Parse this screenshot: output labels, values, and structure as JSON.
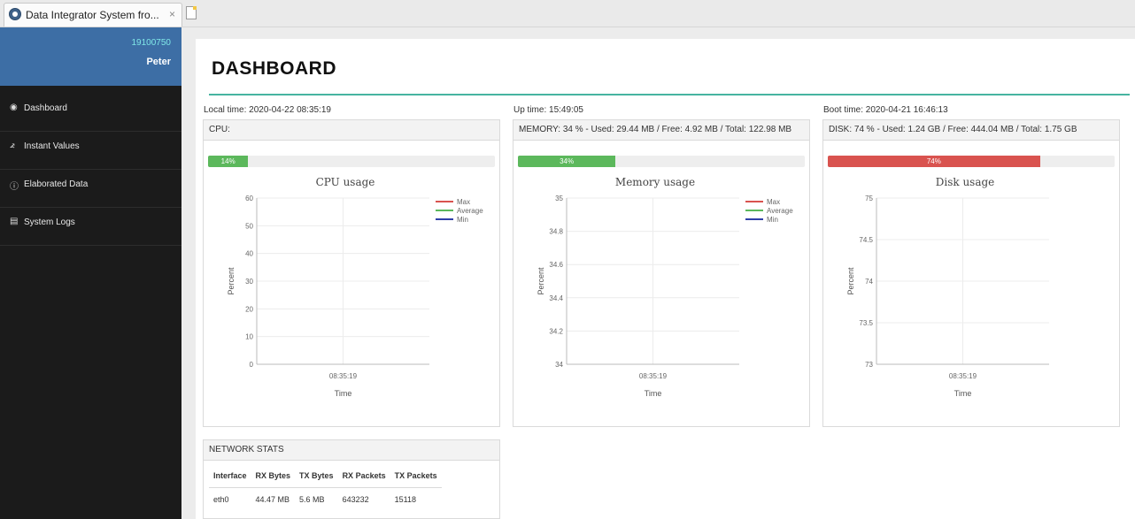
{
  "browser": {
    "tab_title": "Data Integrator System fro...",
    "tab_close": "×"
  },
  "sidebar": {
    "user_id": "19100750",
    "user_name": "Peter",
    "items": [
      {
        "label": "Dashboard",
        "icon": "dashboard-icon",
        "glyph": "◉"
      },
      {
        "label": "Instant Values",
        "icon": "line-chart-icon",
        "glyph": "⦨"
      },
      {
        "label": "Elaborated Data",
        "icon": "info-icon",
        "glyph": "ⓘ"
      },
      {
        "label": "System Logs",
        "icon": "list-icon",
        "glyph": "▤"
      }
    ]
  },
  "header": {
    "title": "DASHBOARD",
    "accent_color": "#46b4a0"
  },
  "info": {
    "local_time": "Local time: 2020-04-22 08:35:19",
    "up_time": "Up time: 15:49:05",
    "boot_time": "Boot time: 2020-04-21 16:46:13"
  },
  "cards": {
    "cpu": {
      "header": "CPU:",
      "percent": 14,
      "percent_label": "14%",
      "bar_color": "#5cb85c"
    },
    "memory": {
      "header": "MEMORY: 34 % - Used: 29.44 MB / Free: 4.92 MB / Total: 122.98 MB",
      "percent": 34,
      "percent_label": "34%",
      "bar_color": "#5cb85c"
    },
    "disk": {
      "header": "DISK: 74 % - Used: 1.24 GB / Free: 444.04 MB / Total: 1.75 GB",
      "percent": 74,
      "percent_label": "74%",
      "bar_color": "#d9534f"
    }
  },
  "chart_data": [
    {
      "type": "line",
      "title": "CPU usage",
      "xlabel": "Time",
      "ylabel": "Percent",
      "x": [
        "08:35:19"
      ],
      "yticks": [
        0,
        10,
        20,
        30,
        40,
        50,
        60
      ],
      "ytick_labels": [
        "0",
        "10",
        "20",
        "30",
        "40",
        "50",
        "60"
      ],
      "ylim": [
        0,
        60
      ],
      "grid": true,
      "legend_position": "top-right",
      "series": [
        {
          "name": "Max",
          "color": "#d9534f",
          "values": []
        },
        {
          "name": "Average",
          "color": "#5cb85c",
          "values": []
        },
        {
          "name": "Min",
          "color": "#2f3fa8",
          "values": []
        }
      ]
    },
    {
      "type": "line",
      "title": "Memory usage",
      "xlabel": "Time",
      "ylabel": "Percent",
      "x": [
        "08:35:19"
      ],
      "yticks": [
        34,
        34.2,
        34.4,
        34.6,
        34.8,
        35
      ],
      "ytick_labels": [
        "34",
        "34.2",
        "34.4",
        "34.6",
        "34.8",
        "35"
      ],
      "ylim": [
        34,
        35
      ],
      "grid": true,
      "legend_position": "top-right",
      "series": [
        {
          "name": "Max",
          "color": "#d9534f",
          "values": []
        },
        {
          "name": "Average",
          "color": "#5cb85c",
          "values": []
        },
        {
          "name": "Min",
          "color": "#2f3fa8",
          "values": []
        }
      ]
    },
    {
      "type": "line",
      "title": "Disk usage",
      "xlabel": "Time",
      "ylabel": "Percent",
      "x": [
        "08:35:19"
      ],
      "yticks": [
        73,
        73.5,
        74,
        74.5,
        75
      ],
      "ytick_labels": [
        "73",
        "73.5",
        "74",
        "74.5",
        "75"
      ],
      "ylim": [
        73,
        75
      ],
      "grid": true,
      "legend_position": "none",
      "series": []
    }
  ],
  "network": {
    "header": "NETWORK STATS",
    "columns": [
      "Interface",
      "RX Bytes",
      "TX Bytes",
      "RX Packets",
      "TX Packets"
    ],
    "rows": [
      [
        "eth0",
        "44.47 MB",
        "5.6 MB",
        "643232",
        "15118"
      ]
    ]
  }
}
